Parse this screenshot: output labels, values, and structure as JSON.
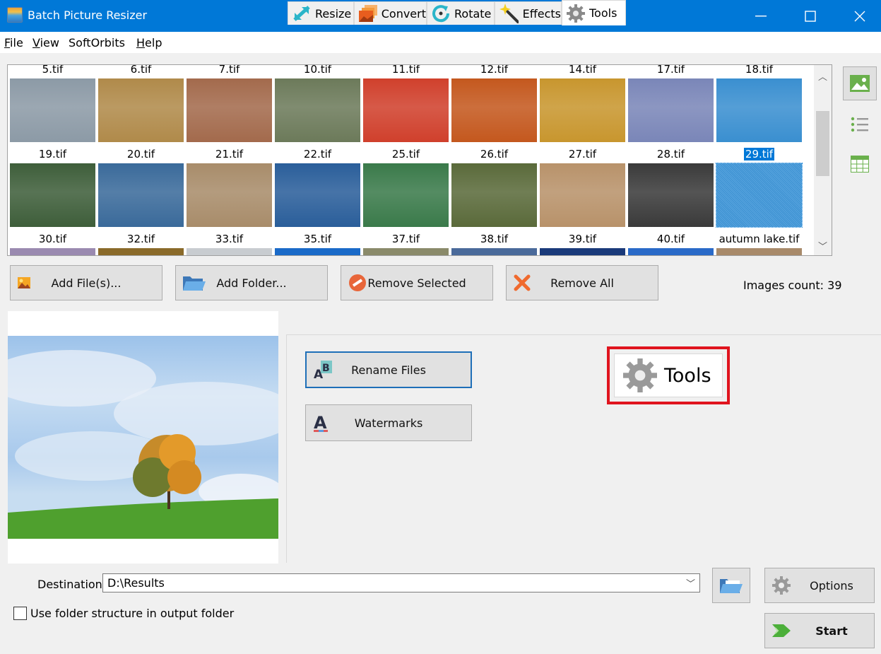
{
  "window": {
    "title": "Batch Picture Resizer",
    "controls": {
      "minimize": "—",
      "maximize": "☐",
      "close": "✕"
    }
  },
  "menu": [
    {
      "label": "File",
      "mnemonic": "F",
      "rest": "ile"
    },
    {
      "label": "View",
      "mnemonic": "V",
      "rest": "iew"
    },
    {
      "label": "SoftOrbits",
      "mnemonic": "",
      "rest": "SoftOrbits"
    },
    {
      "label": "Help",
      "mnemonic": "H",
      "rest": "elp"
    }
  ],
  "gallery": {
    "rows": [
      [
        "5.tif",
        "6.tif",
        "7.tif",
        "10.tif",
        "11.tif",
        "12.tif",
        "14.tif",
        "17.tif",
        "18.tif"
      ],
      [
        "19.tif",
        "20.tif",
        "21.tif",
        "22.tif",
        "25.tif",
        "26.tif",
        "27.tif",
        "28.tif",
        "29.tif"
      ],
      [
        "30.tif",
        "32.tif",
        "33.tif",
        "35.tif",
        "37.tif",
        "38.tif",
        "39.tif",
        "40.tif",
        "autumn lake.tif"
      ]
    ],
    "selected": "29.tif",
    "thumb_colors": [
      [
        "#8c9aa6",
        "#b08a4a",
        "#a36a4c",
        "#6c7a5a",
        "#d0402c",
        "#c4581e",
        "#c8962e",
        "#7a86b8",
        "#3a8fd0"
      ],
      [
        "#3e5e3a",
        "#3a6a9a",
        "#a88c6a",
        "#2a5e9a",
        "#3a7a4a",
        "#5a6a3a",
        "#b8926a",
        "#3a3a3a",
        "#d89aa0"
      ],
      [
        "#9a8ab0",
        "#8a6a2a",
        "#c8ccd0",
        "#1a6ac8",
        "#8a8a6a",
        "#4a6a9a",
        "#1a3a7a",
        "#2a6ac8",
        "#a88a6a"
      ]
    ]
  },
  "view_modes": [
    "thumbnails-view",
    "list-view",
    "table-view"
  ],
  "actions": {
    "add_files": "Add File(s)...",
    "add_folder": "Add Folder...",
    "remove_selected": "Remove Selected",
    "remove_all": "Remove All"
  },
  "images_count": "Images count: 39",
  "tabs": [
    {
      "label": "Resize",
      "active": false
    },
    {
      "label": "Convert",
      "active": false
    },
    {
      "label": "Rotate",
      "active": false
    },
    {
      "label": "Effects",
      "active": false
    },
    {
      "label": "Tools",
      "active": true
    }
  ],
  "tools_panel": {
    "rename_files": "Rename Files",
    "watermarks": "Watermarks",
    "callout_label": "Tools"
  },
  "destination": {
    "label": "Destination",
    "value": "D:\\Results"
  },
  "use_folder_structure": {
    "label": "Use folder structure in output folder",
    "checked": false
  },
  "options_label": "Options",
  "start_label": "Start",
  "colors": {
    "titlebar": "#0078d7",
    "selection": "#0078d7",
    "callout_border": "#e0141e"
  }
}
